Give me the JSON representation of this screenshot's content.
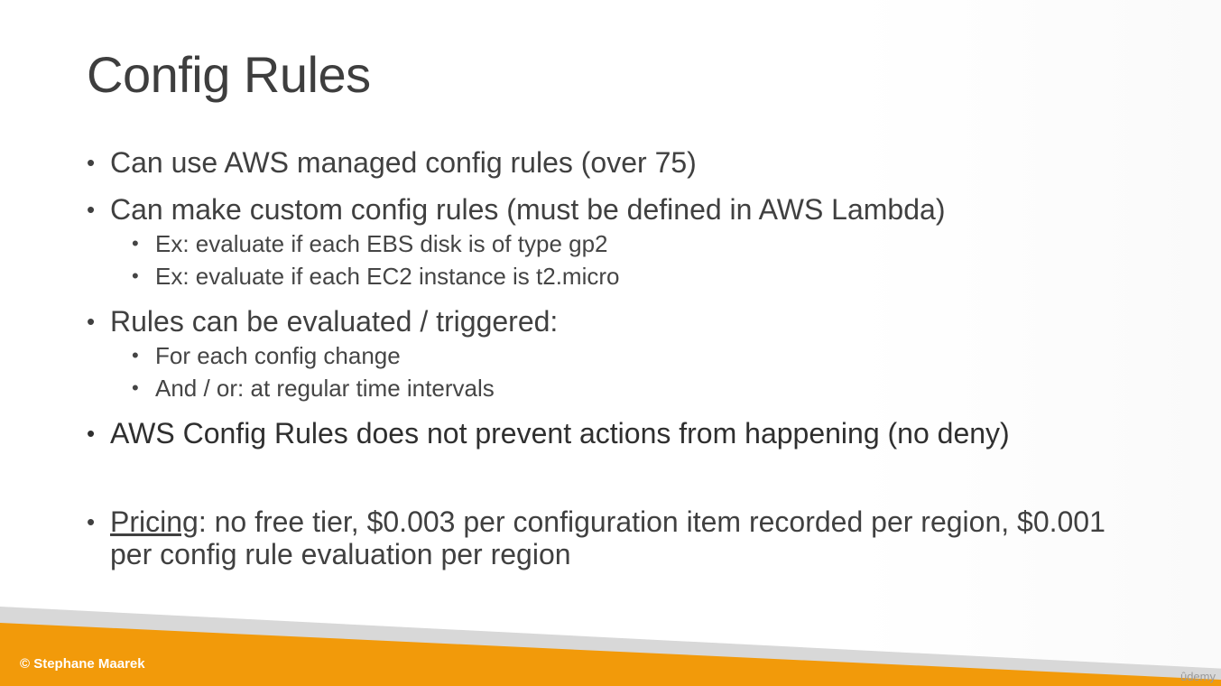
{
  "slide": {
    "title": "Config Rules",
    "bullets": {
      "b1": "Can use AWS managed config rules (over 75)",
      "b2": "Can make custom config rules (must be defined in AWS Lambda)",
      "b2_sub1": "Ex: evaluate if each EBS disk is of type gp2",
      "b2_sub2": "Ex: evaluate if each EC2 instance is t2.micro",
      "b3": "Rules can be evaluated / triggered:",
      "b3_sub1": "For each config change",
      "b3_sub2": "And / or: at regular time intervals",
      "b4": "AWS Config Rules does not prevent actions from happening (no deny)",
      "pricing_label": "Pricing",
      "pricing_text": ": no free tier, $0.003 per configuration item recorded per region, $0.001 per config rule evaluation per region"
    }
  },
  "footer": {
    "copyright": "© Stephane Maarek",
    "watermark": "ûdemy"
  },
  "colors": {
    "accent_orange": "#f29a0a",
    "band_gray": "#d8d8d8",
    "text": "#404040"
  }
}
